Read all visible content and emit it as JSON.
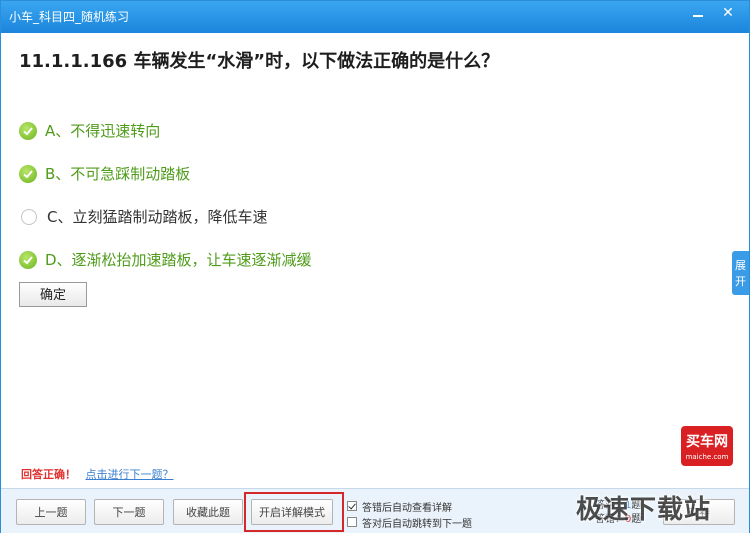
{
  "window": {
    "title": "小车_科目四_随机练习"
  },
  "window_buttons": {
    "minimize": "",
    "close": "✕"
  },
  "question": {
    "text": "11.1.1.166 车辆发生“水滑”时，以下做法正确的是什么？"
  },
  "options": [
    {
      "label": "A、不得迅速转向",
      "selected": true
    },
    {
      "label": "B、不可急踩制动踏板",
      "selected": true
    },
    {
      "label": "C、立刻猛踏制动踏板，降低车速",
      "selected": false
    },
    {
      "label": "D、逐渐松抬加速踏板，让车速逐渐减缓",
      "selected": true
    }
  ],
  "confirm_label": "确定",
  "side_tab": {
    "line1": "展",
    "line2": "开"
  },
  "logo": {
    "name": "买车网",
    "domain": "maiche.com"
  },
  "status": {
    "result": "回答正确！",
    "next_link": "点击进行下一题？"
  },
  "bottom": {
    "prev": "上一题",
    "next": "下一题",
    "favorite": "收藏此题",
    "detail_mode": "开启详解模式",
    "check_wrong_detail": "答错后自动查看详解",
    "check_right_next": "答对后自动跳转到下一题",
    "submit": "交卷"
  },
  "counts": {
    "correct_label": "答对：",
    "correct_value": "1",
    "wrong_label": "答错：",
    "wrong_value": "0",
    "unit": "题"
  },
  "watermark": "极速下载站",
  "colors": {
    "titlebar": "#1b86dc",
    "correct_text": "#4f9c1a",
    "result": "#e03030",
    "highlight": "#d52727"
  }
}
